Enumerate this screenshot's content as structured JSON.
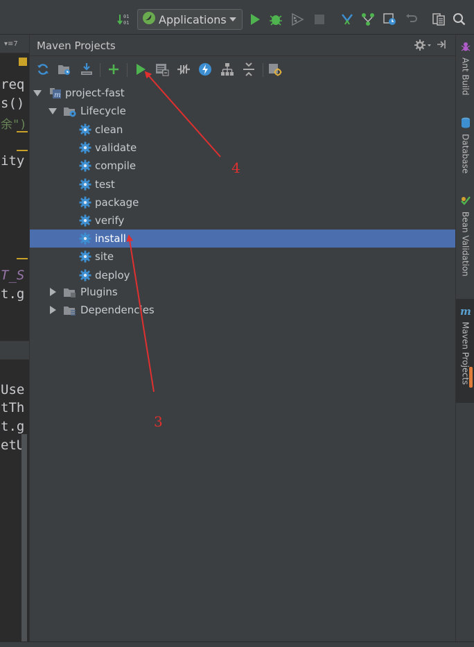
{
  "toolbar": {
    "run_config_label": "Applications",
    "icons": [
      "sort-icon",
      "spring-boot-icon",
      "run-icon",
      "debug-icon",
      "coverage-icon",
      "stop-icon",
      "vcs-update-icon",
      "vcs-commit-icon",
      "vcs-history-icon",
      "undo-icon",
      "project-structure-icon",
      "search-icon"
    ]
  },
  "editor": {
    "tab_label": "▾≡7",
    "code_lines": [
      "req",
      "s()",
      "余\")",
      "ity",
      "T_S",
      "t.g",
      "Use",
      "tTh",
      "t.g",
      "etU"
    ]
  },
  "maven": {
    "title": "Maven Projects",
    "toolbar_icons": [
      "reimport-icon",
      "generate-sources-icon",
      "download-icon",
      "add-icon",
      "run-maven-build-icon",
      "execute-goal-icon",
      "toggle-offline-icon",
      "skip-tests-icon",
      "show-dependencies-icon",
      "collapse-all-icon",
      "maven-settings-icon"
    ],
    "tree": {
      "project": "project-fast",
      "lifecycle_label": "Lifecycle",
      "goals": [
        "clean",
        "validate",
        "compile",
        "test",
        "package",
        "verify",
        "install",
        "site",
        "deploy"
      ],
      "selected_goal": "install",
      "plugins_label": "Plugins",
      "dependencies_label": "Dependencies"
    }
  },
  "right_sidebar": {
    "tabs": [
      "Ant Build",
      "Database",
      "Bean Validation",
      "Maven Projects"
    ],
    "active": "Maven Projects"
  },
  "annotations": {
    "label_run": "4",
    "label_install": "3",
    "color": "#e03030"
  },
  "colors": {
    "selection": "#4b6eaf",
    "run_green": "#4fb44f",
    "gear_blue": "#3d8fd1"
  }
}
